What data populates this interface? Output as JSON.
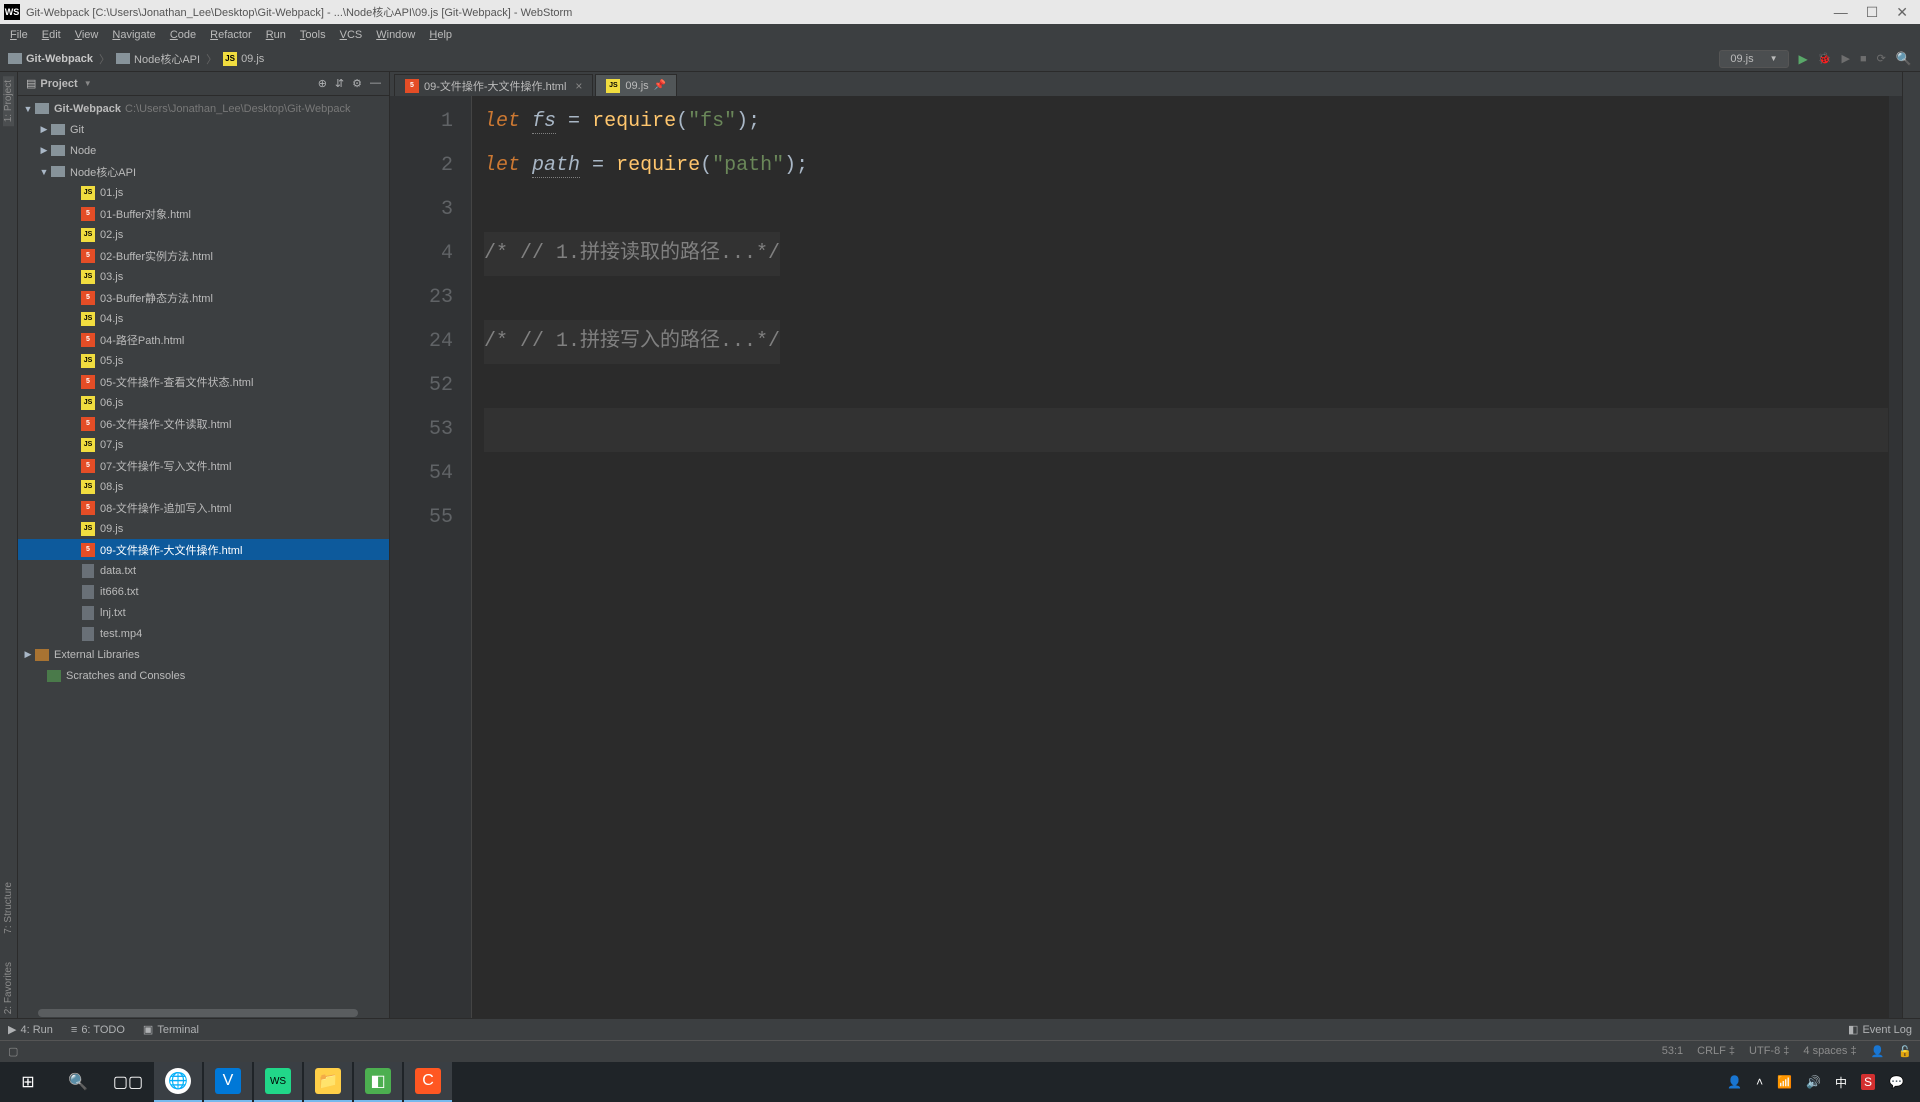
{
  "titlebar": {
    "text": "Git-Webpack [C:\\Users\\Jonathan_Lee\\Desktop\\Git-Webpack] - ...\\Node核心API\\09.js [Git-Webpack] - WebStorm"
  },
  "menu": [
    "File",
    "Edit",
    "View",
    "Navigate",
    "Code",
    "Refactor",
    "Run",
    "Tools",
    "VCS",
    "Window",
    "Help"
  ],
  "breadcrumb": {
    "root": "Git-Webpack",
    "folder": "Node核心API",
    "file": "09.js"
  },
  "run_config": "09.js",
  "project": {
    "title": "Project",
    "root": {
      "name": "Git-Webpack",
      "path": "C:\\Users\\Jonathan_Lee\\Desktop\\Git-Webpack"
    },
    "folders": [
      {
        "name": "Git",
        "expanded": false,
        "depth": 1
      },
      {
        "name": "Node",
        "expanded": false,
        "depth": 1
      },
      {
        "name": "Node核心API",
        "expanded": true,
        "depth": 1
      }
    ],
    "files": [
      {
        "name": "01.js",
        "type": "js"
      },
      {
        "name": "01-Buffer对象.html",
        "type": "html"
      },
      {
        "name": "02.js",
        "type": "js"
      },
      {
        "name": "02-Buffer实例方法.html",
        "type": "html"
      },
      {
        "name": "03.js",
        "type": "js"
      },
      {
        "name": "03-Buffer静态方法.html",
        "type": "html"
      },
      {
        "name": "04.js",
        "type": "js"
      },
      {
        "name": "04-路径Path.html",
        "type": "html"
      },
      {
        "name": "05.js",
        "type": "js"
      },
      {
        "name": "05-文件操作-查看文件状态.html",
        "type": "html"
      },
      {
        "name": "06.js",
        "type": "js"
      },
      {
        "name": "06-文件操作-文件读取.html",
        "type": "html"
      },
      {
        "name": "07.js",
        "type": "js"
      },
      {
        "name": "07-文件操作-写入文件.html",
        "type": "html"
      },
      {
        "name": "08.js",
        "type": "js"
      },
      {
        "name": "08-文件操作-追加写入.html",
        "type": "html"
      },
      {
        "name": "09.js",
        "type": "js"
      },
      {
        "name": "09-文件操作-大文件操作.html",
        "type": "html",
        "selected": true
      },
      {
        "name": "data.txt",
        "type": "txt"
      },
      {
        "name": "it666.txt",
        "type": "txt"
      },
      {
        "name": "lnj.txt",
        "type": "txt"
      },
      {
        "name": "test.mp4",
        "type": "txt"
      }
    ],
    "extras": [
      {
        "name": "External Libraries",
        "type": "lib"
      },
      {
        "name": "Scratches and Consoles",
        "type": "sc"
      }
    ]
  },
  "tabs": [
    {
      "name": "09-文件操作-大文件操作.html",
      "type": "html",
      "active": false
    },
    {
      "name": "09.js",
      "type": "js",
      "active": true
    }
  ],
  "code": {
    "line_numbers": [
      "1",
      "2",
      "3",
      "4",
      "23",
      "24",
      "52",
      "53",
      "54",
      "55"
    ],
    "line1_kw": "let",
    "line1_var": "fs",
    "line1_eq": " = ",
    "line1_fn": "require",
    "line1_paren_open": "(",
    "line1_str": "\"fs\"",
    "line1_end": ");",
    "line2_kw": "let",
    "line2_var": "path",
    "line2_eq": " = ",
    "line2_fn": "require",
    "line2_paren_open": "(",
    "line2_str": "\"path\"",
    "line2_end": ");",
    "line4": "/* // 1.拼接读取的路径...*/",
    "line24": "/* // 1.拼接写入的路径...*/"
  },
  "side_tools": {
    "project": "1: Project",
    "structure": "7: Structure",
    "favorites": "2: Favorites"
  },
  "bottom_tools": {
    "run": "4: Run",
    "todo": "6: TODO",
    "terminal": "Terminal",
    "event_log": "Event Log"
  },
  "status": {
    "pos": "53:1",
    "sep": "CRLF ‡",
    "enc": "UTF-8 ‡",
    "indent": "4 spaces ‡"
  },
  "tray": {
    "time": ""
  }
}
